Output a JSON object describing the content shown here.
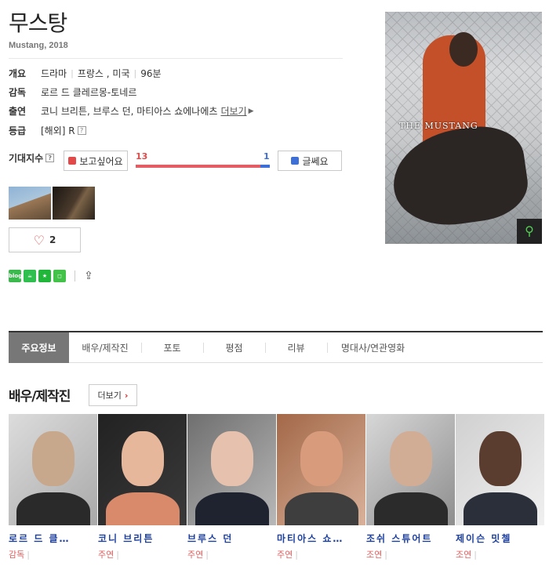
{
  "movie": {
    "title": "무스탕",
    "subtitle": "Mustang, 2018"
  },
  "info": {
    "overview": {
      "label": "개요",
      "genre": "드라마",
      "countries": "프랑스 , 미국",
      "runtime": "96분"
    },
    "director": {
      "label": "감독",
      "name": "로르 드 클레르몽-토네르"
    },
    "cast": {
      "label": "출연",
      "names": "코니 브리튼, 브루스 던, 마티아스 쇼에나에츠",
      "more": "더보기"
    },
    "rating": {
      "label": "등급",
      "value": "[해외] R"
    }
  },
  "help_icon": "?",
  "anticipation": {
    "label": "기대지수",
    "want_label": "보고싶어요",
    "dont_want_label": "글쎄요",
    "want_count": "13",
    "dont_want_count": "1",
    "want_ratio": 0.93,
    "colors": {
      "want": "#e45c64",
      "dont_want": "#3d6fd6"
    }
  },
  "poster": {
    "title_text": "THE MUSTANG",
    "zoom_icon": "magnifier-icon"
  },
  "like": {
    "count": "2"
  },
  "share": {
    "blog": "blog"
  },
  "tabs": [
    {
      "label": "주요정보"
    },
    {
      "label": "배우/제작진"
    },
    {
      "label": "포토"
    },
    {
      "label": "평점"
    },
    {
      "label": "리뷰"
    },
    {
      "label": "명대사/연관영화"
    }
  ],
  "cast_section": {
    "title": "배우/제작진",
    "more_label": "더보기",
    "people": [
      {
        "name": "로르 드 클…",
        "role": "감독"
      },
      {
        "name": "코니 브리튼",
        "role": "주연"
      },
      {
        "name": "브루스 던",
        "role": "주연"
      },
      {
        "name": "마티아스 쇼…",
        "role": "주연"
      },
      {
        "name": "조쉬 스튜어트",
        "role": "조연"
      },
      {
        "name": "제이슨 밋첼",
        "role": "조연"
      }
    ]
  }
}
